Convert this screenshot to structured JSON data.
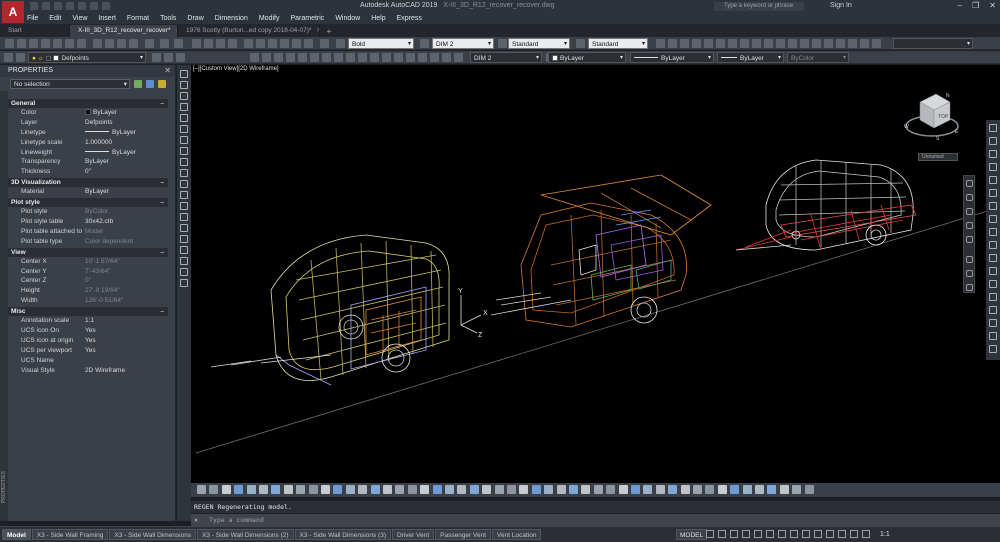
{
  "app": {
    "logo_letter": "A",
    "title": "Autodesk AutoCAD 2019",
    "file_title": "X-III_3D_R12_recover_recover.dwg",
    "search_placeholder": "Type a keyword or phrase",
    "signin": "Sign In",
    "window_buttons": [
      "–",
      "❐",
      "✕"
    ]
  },
  "menu": [
    "File",
    "Edit",
    "View",
    "Insert",
    "Format",
    "Tools",
    "Draw",
    "Dimension",
    "Modify",
    "Parametric",
    "Window",
    "Help",
    "Express"
  ],
  "doc_tabs": [
    {
      "label": "Start",
      "active": false,
      "close": ""
    },
    {
      "label": "X-III_3D_R12_recover_recover*",
      "active": true,
      "close": "✕"
    },
    {
      "label": "1976 Scotty (Burton...ed copy 2018-04-07)*",
      "active": false,
      "close": "✕"
    }
  ],
  "toolbar": {
    "text_style": "Bold",
    "dim_style": "DIM 2",
    "table_style": "Standard",
    "multileader_style": "Standard",
    "layer": "Defpoints",
    "dim_style_2": "DIM 2",
    "color": "ByLayer",
    "linetype": "ByLayer",
    "lineweight": "ByLayer",
    "plot_style": "ByColor"
  },
  "palette": {
    "title": "PROPERTIES",
    "close": "✕",
    "selection": "No selection",
    "strip_label": "PROPERTIES",
    "sections": [
      {
        "name": "General",
        "rows": [
          {
            "k": "Color",
            "v": "ByLayer",
            "swatch": true
          },
          {
            "k": "Layer",
            "v": "Defpoints"
          },
          {
            "k": "Linetype",
            "v": "ByLayer",
            "line": true
          },
          {
            "k": "Linetype scale",
            "v": "1.000000"
          },
          {
            "k": "Lineweight",
            "v": "ByLayer",
            "line": true
          },
          {
            "k": "Transparency",
            "v": "ByLayer"
          },
          {
            "k": "Thickness",
            "v": "0\""
          }
        ]
      },
      {
        "name": "3D Visualization",
        "rows": [
          {
            "k": "Material",
            "v": "ByLayer"
          }
        ]
      },
      {
        "name": "Plot style",
        "rows": [
          {
            "k": "Plot style",
            "v": "ByColor",
            "dim": true
          },
          {
            "k": "Plot style table",
            "v": "30x42.ctb"
          },
          {
            "k": "Plot table attached to",
            "v": "Model",
            "dim": true
          },
          {
            "k": "Plot table type",
            "v": "Color dependent",
            "dim": true
          }
        ]
      },
      {
        "name": "View",
        "rows": [
          {
            "k": "Center X",
            "v": "10'-1 57/64\"",
            "dim": true
          },
          {
            "k": "Center Y",
            "v": "7'-43/64\"",
            "dim": true
          },
          {
            "k": "Center Z",
            "v": "0\"",
            "dim": true
          },
          {
            "k": "Height",
            "v": "27'-9 19/64\"",
            "dim": true
          },
          {
            "k": "Width",
            "v": "126'-0 51/64\"",
            "dim": true
          }
        ]
      },
      {
        "name": "Misc",
        "rows": [
          {
            "k": "Annotation scale",
            "v": "1:1"
          },
          {
            "k": "UCS icon On",
            "v": "Yes"
          },
          {
            "k": "UCS icon at origin",
            "v": "Yes"
          },
          {
            "k": "UCS per viewport",
            "v": "Yes"
          },
          {
            "k": "UCS Name",
            "v": ""
          },
          {
            "k": "Visual Style",
            "v": "2D Wireframe"
          }
        ]
      }
    ]
  },
  "viewport": {
    "label": "[–][Custom View][2D Wireframe]",
    "viewcube_face": "TOP",
    "compass": [
      "N",
      "E",
      "S",
      "W"
    ],
    "named_view": "Unnamed",
    "ucs_axes": [
      "X",
      "Y",
      "Z"
    ]
  },
  "command": {
    "history": "REGEN Regenerating model.",
    "placeholder": "Type a command",
    "close": "✕"
  },
  "layout_tabs": [
    {
      "label": "Model",
      "active": true
    },
    {
      "label": "X3 - Side Wall Framing",
      "active": false
    },
    {
      "label": "X3 - Side Wall Dimensions",
      "active": false
    },
    {
      "label": "X3 - Side Wall Dimensions (2)",
      "active": false
    },
    {
      "label": "X3 - Side Wall Dimensions (3)",
      "active": false
    },
    {
      "label": "Driver Vent",
      "active": false
    },
    {
      "label": "Passenger Vent",
      "active": false
    },
    {
      "label": "Vent Location",
      "active": false
    }
  ],
  "status": {
    "mode": "MODEL",
    "scale": "1:1"
  }
}
